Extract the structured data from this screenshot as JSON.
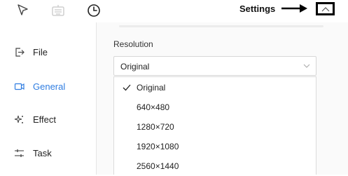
{
  "toolbar": {
    "tools": [
      {
        "icon": "cursor-icon"
      },
      {
        "icon": "keyboard-icon"
      },
      {
        "icon": "clock-icon"
      }
    ],
    "settings_label": "Settings"
  },
  "sidebar": {
    "items": [
      {
        "label": "File",
        "icon": "file-export-icon",
        "active": false
      },
      {
        "label": "General",
        "icon": "video-camera-icon",
        "active": true
      },
      {
        "label": "Effect",
        "icon": "sparkle-icon",
        "active": false
      },
      {
        "label": "Task",
        "icon": "sliders-icon",
        "active": false
      }
    ]
  },
  "resolution": {
    "label": "Resolution",
    "selected": "Original",
    "options": [
      "Original",
      "640×480",
      "1280×720",
      "1920×1080",
      "2560×1440"
    ]
  },
  "colors": {
    "accent": "#2f7de1",
    "sidebar_bg": "#ffffff",
    "content_bg": "#fafafa"
  }
}
